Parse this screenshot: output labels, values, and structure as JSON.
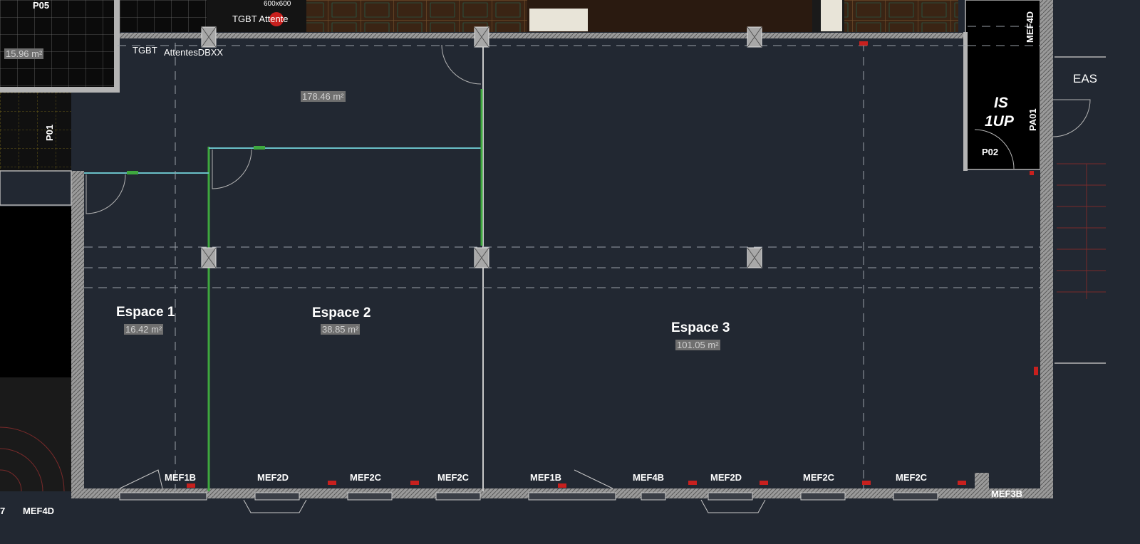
{
  "colors": {
    "background": "#222832",
    "wall": "#b4b4b4",
    "partition": "#3ea83e",
    "dark_block": "#000000",
    "marker": "#c8201e"
  },
  "top_labels": {
    "p05": "P05",
    "area_15": "15.96 m²",
    "tile_600": "600x600",
    "tgbt_attente": "TGBT Attente",
    "tgbt": "TGBT",
    "attentes_dbxx": "AttentesDBXX",
    "p01": "P01",
    "mef4d_top": "MEF4D",
    "eas": "EAS",
    "is_line1": "IS",
    "is_line2": "1UP",
    "pa01": "PA01",
    "p02": "P02",
    "area_178": "178.46 m²"
  },
  "spaces": [
    {
      "name": "Espace 1",
      "area": "16.42 m²"
    },
    {
      "name": "Espace 2",
      "area": "38.85 m²"
    },
    {
      "name": "Espace 3",
      "area": "101.05 m²"
    }
  ],
  "facade_tags": [
    "MEF1B",
    "MEF2D",
    "MEF2C",
    "MEF2C",
    "MEF1B",
    "MEF4B",
    "MEF2D",
    "MEF2C",
    "MEF2C"
  ],
  "bottom_labels": {
    "mef3b": "MEF3B",
    "mef4d": "MEF4D",
    "edge_digit": "7"
  }
}
